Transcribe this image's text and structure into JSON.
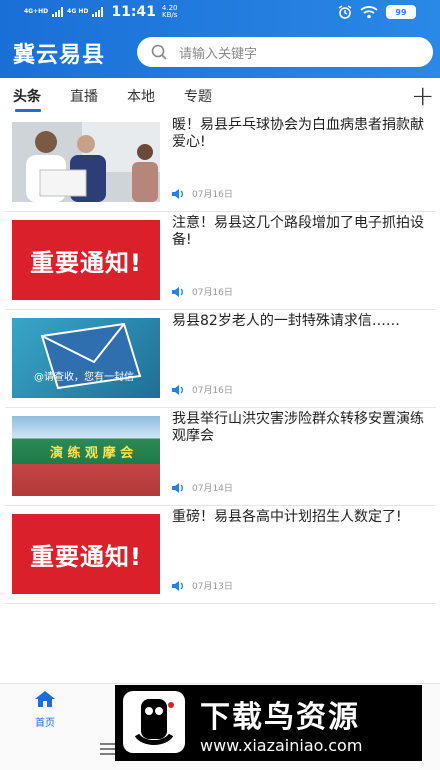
{
  "statusbar": {
    "network1": "4G+HD",
    "network2": "4G HD",
    "time": "11:41",
    "speed_value": "4.20",
    "speed_unit": "KB/s",
    "battery": "99"
  },
  "header": {
    "app_title": "冀云易县",
    "search_placeholder": "请输入关键字"
  },
  "tabs": [
    {
      "label": "头条",
      "active": true
    },
    {
      "label": "直播",
      "active": false
    },
    {
      "label": "本地",
      "active": false
    },
    {
      "label": "专题",
      "active": false
    }
  ],
  "news": [
    {
      "title": "暖！易县乒乓球协会为白血病患者捐款献爱心!",
      "date": "07月16日",
      "thumb": "photo"
    },
    {
      "title": "注意！易县这几个路段增加了电子抓拍设备!",
      "date": "07月16日",
      "thumb": "notice",
      "thumb_text": "重要通知!"
    },
    {
      "title": "易县82岁老人的一封特殊请求信……",
      "date": "07月16日",
      "thumb": "envelope",
      "thumb_text": "@请查收，您有一封信"
    },
    {
      "title": "我县举行山洪灾害涉险群众转移安置演练观摩会",
      "date": "07月14日",
      "thumb": "banner",
      "thumb_text": "演 练 观 摩 会"
    },
    {
      "title": "重磅！易县各高中计划招生人数定了!",
      "date": "07月13日",
      "thumb": "notice",
      "thumb_text": "重要通知!"
    }
  ],
  "bottom_nav": {
    "home_label": "首页"
  },
  "watermark": {
    "title": "下载鸟资源",
    "url": "www.xiazainiao.com"
  },
  "colors": {
    "primary": "#1a6fd6",
    "notice_red": "#d9202b"
  }
}
